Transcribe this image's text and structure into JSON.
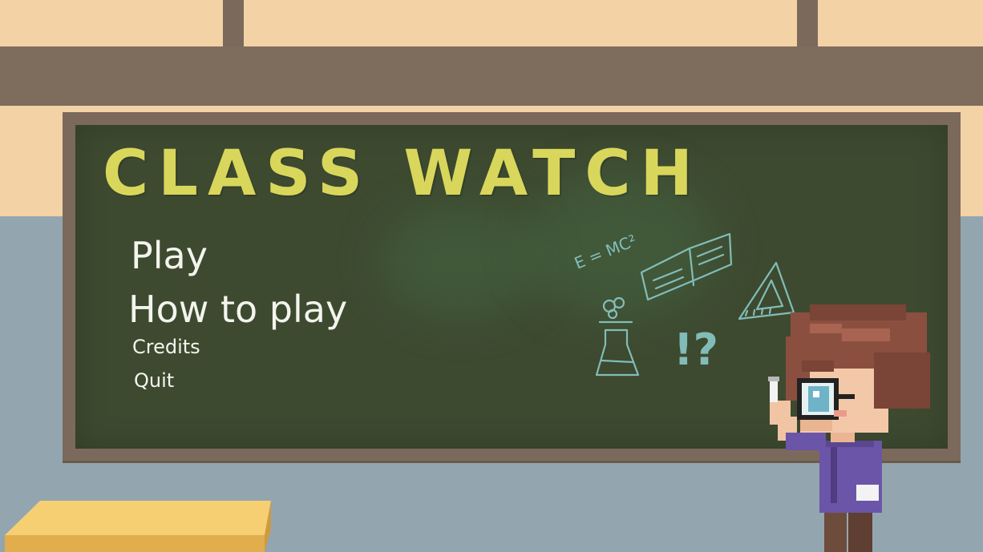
{
  "game": {
    "title": "CLASS WATCH"
  },
  "menu": {
    "play": "Play",
    "how_to_play": "How to play",
    "credits": "Credits",
    "quit": "Quit"
  },
  "doodles": {
    "formula": "E = MC²",
    "punctuation": "!?"
  },
  "colors": {
    "chalkboard": "#3d4a30",
    "frame": "#7b6a5b",
    "title_chalk": "#d9d65c",
    "menu_chalk": "#f4f4ee",
    "doodle_chalk": "#8fd0d0",
    "wall_upper": "#f3d2a5",
    "wall_lower": "#93a6b0"
  }
}
